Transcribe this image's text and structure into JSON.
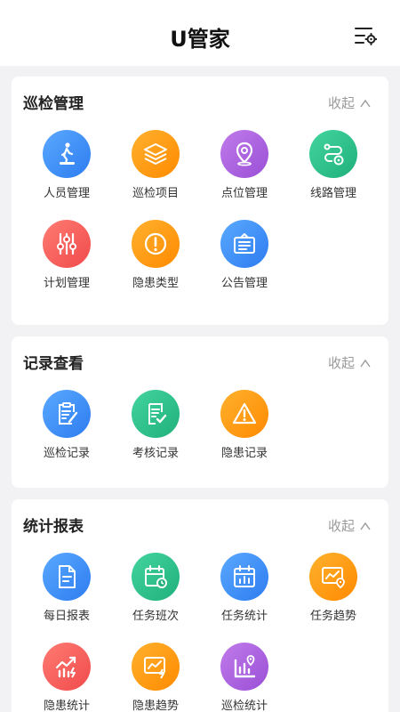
{
  "header": {
    "title": "U管家",
    "settings_icon": "settings-list-icon"
  },
  "colors": {
    "blue": "#2d7cf0",
    "orange": "#ff8a00",
    "purple": "#9a4fd6",
    "green": "#1fb07b",
    "red": "#f04b4b",
    "background": "#f2f2f4"
  },
  "sections": [
    {
      "title": "巡检管理",
      "collapse_label": "收起",
      "items": [
        {
          "label": "人员管理",
          "icon": "walking-person-icon",
          "color": "blue"
        },
        {
          "label": "巡检项目",
          "icon": "layers-icon",
          "color": "orange"
        },
        {
          "label": "点位管理",
          "icon": "location-pin-icon",
          "color": "purple"
        },
        {
          "label": "线路管理",
          "icon": "route-gear-icon",
          "color": "green"
        },
        {
          "label": "计划管理",
          "icon": "sliders-icon",
          "color": "red"
        },
        {
          "label": "隐患类型",
          "icon": "alert-circle-icon",
          "color": "orange"
        },
        {
          "label": "公告管理",
          "icon": "announcement-board-icon",
          "color": "blue"
        }
      ]
    },
    {
      "title": "记录查看",
      "collapse_label": "收起",
      "items": [
        {
          "label": "巡检记录",
          "icon": "clipboard-edit-icon",
          "color": "blue"
        },
        {
          "label": "考核记录",
          "icon": "checklist-icon",
          "color": "green"
        },
        {
          "label": "隐患记录",
          "icon": "warning-triangle-icon",
          "color": "orange"
        }
      ]
    },
    {
      "title": "统计报表",
      "collapse_label": "收起",
      "items": [
        {
          "label": "每日报表",
          "icon": "document-icon",
          "color": "blue"
        },
        {
          "label": "任务班次",
          "icon": "calendar-clock-icon",
          "color": "green"
        },
        {
          "label": "任务统计",
          "icon": "calendar-chart-icon",
          "color": "blue"
        },
        {
          "label": "任务趋势",
          "icon": "trend-chart-icon",
          "color": "orange"
        },
        {
          "label": "隐患统计",
          "icon": "chart-alert-icon",
          "color": "red"
        },
        {
          "label": "隐患趋势",
          "icon": "trend-alert-icon",
          "color": "orange"
        },
        {
          "label": "巡检统计",
          "icon": "bar-location-icon",
          "color": "purple"
        }
      ]
    }
  ]
}
